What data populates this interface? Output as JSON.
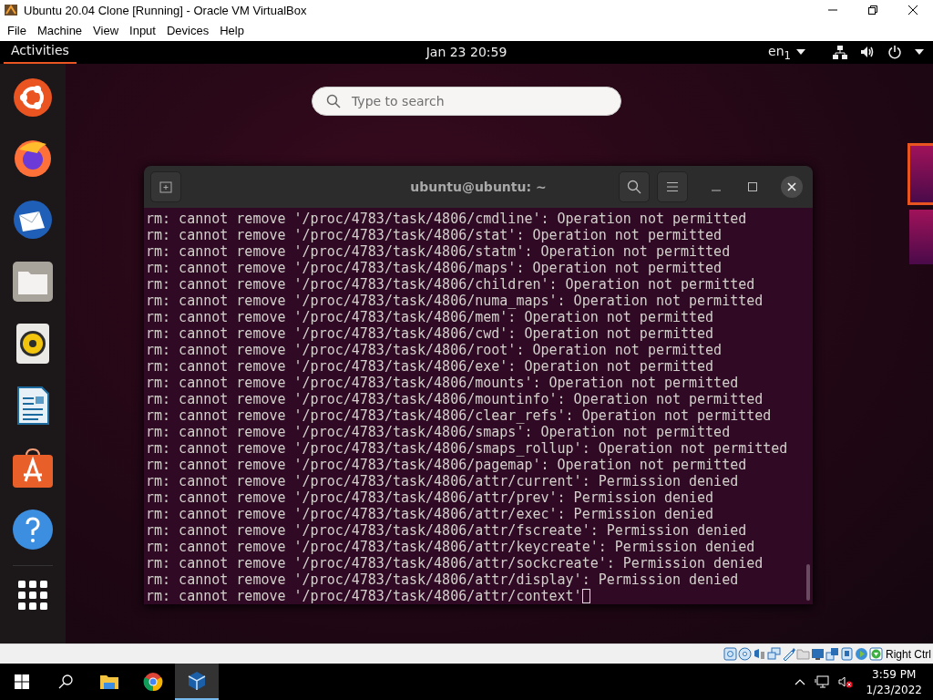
{
  "window": {
    "title": "Ubuntu 20.04 Clone [Running] - Oracle VM VirtualBox"
  },
  "menu": [
    "File",
    "Machine",
    "View",
    "Input",
    "Devices",
    "Help"
  ],
  "guest": {
    "topbar": {
      "activities": "Activities",
      "clock": "Jan 23  20:59",
      "keyboard_layout": "en$_{1}$"
    },
    "search": {
      "placeholder": "Type to search"
    },
    "workspaces": [
      {
        "selected": true
      },
      {
        "selected": false
      }
    ],
    "terminal": {
      "title": "ubuntu@ubuntu: ~",
      "lines": [
        "rm: cannot remove '/proc/4783/task/4806/cmdline': Operation not permitted",
        "rm: cannot remove '/proc/4783/task/4806/stat': Operation not permitted",
        "rm: cannot remove '/proc/4783/task/4806/statm': Operation not permitted",
        "rm: cannot remove '/proc/4783/task/4806/maps': Operation not permitted",
        "rm: cannot remove '/proc/4783/task/4806/children': Operation not permitted",
        "rm: cannot remove '/proc/4783/task/4806/numa_maps': Operation not permitted",
        "rm: cannot remove '/proc/4783/task/4806/mem': Operation not permitted",
        "rm: cannot remove '/proc/4783/task/4806/cwd': Operation not permitted",
        "rm: cannot remove '/proc/4783/task/4806/root': Operation not permitted",
        "rm: cannot remove '/proc/4783/task/4806/exe': Operation not permitted",
        "rm: cannot remove '/proc/4783/task/4806/mounts': Operation not permitted",
        "rm: cannot remove '/proc/4783/task/4806/mountinfo': Operation not permitted",
        "rm: cannot remove '/proc/4783/task/4806/clear_refs': Operation not permitted",
        "rm: cannot remove '/proc/4783/task/4806/smaps': Operation not permitted",
        "rm: cannot remove '/proc/4783/task/4806/smaps_rollup': Operation not permitted",
        "rm: cannot remove '/proc/4783/task/4806/pagemap': Operation not permitted",
        "rm: cannot remove '/proc/4783/task/4806/attr/current': Permission denied",
        "rm: cannot remove '/proc/4783/task/4806/attr/prev': Permission denied",
        "rm: cannot remove '/proc/4783/task/4806/attr/exec': Permission denied",
        "rm: cannot remove '/proc/4783/task/4806/attr/fscreate': Permission denied",
        "rm: cannot remove '/proc/4783/task/4806/attr/keycreate': Permission denied",
        "rm: cannot remove '/proc/4783/task/4806/attr/sockcreate': Permission denied",
        "rm: cannot remove '/proc/4783/task/4806/attr/display': Permission denied",
        "rm: cannot remove '/proc/4783/task/4806/attr/context'"
      ]
    }
  },
  "status_bar": {
    "host_key": "Right Ctrl"
  },
  "taskbar": {
    "time": "3:59 PM",
    "date": "1/23/2022"
  }
}
